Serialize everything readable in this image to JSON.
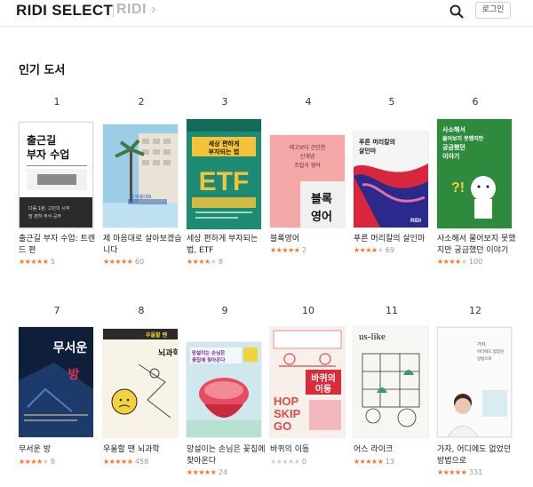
{
  "header": {
    "logo": "RIDI SELECT",
    "logo_secondary": "RIDI",
    "login_label": "로그인",
    "search_icon": "search-icon"
  },
  "section": {
    "title": "인기 도서"
  },
  "books": [
    {
      "rank": "1",
      "title": "출근길 부자 수업: 트렌드 편",
      "rating": 5,
      "reviews": "5",
      "cover_text": "출근길\n부자 수업",
      "cover_text_small": "다음 1분, 고민의 시작\n맘 편히 주식 공부"
    },
    {
      "rank": "2",
      "title": "제 마음대로 살아보겠습니다",
      "rating": 4.5,
      "reviews": "60",
      "cover_text": "제 마음대로 살아보겠습니다",
      "cover_text_small": ""
    },
    {
      "rank": "3",
      "title": "세상 편하게 부자되는 법, ETF",
      "rating": 3.5,
      "reviews": "8",
      "cover_text": "세상 편하게\n부자되는 법",
      "cover_text_small": "ETF"
    },
    {
      "rank": "4",
      "title": "블록영어",
      "rating": 5,
      "reviews": "2",
      "cover_text": "레고보다 간단한\n신개념\n조립식 영어",
      "cover_text_small": "블록\n영어"
    },
    {
      "rank": "5",
      "title": "푸른 머리칼의 살인마",
      "rating": 4,
      "reviews": "69",
      "cover_text": "푸른 머리칼의\n살인마",
      "cover_text_small": "RIDI"
    },
    {
      "rank": "6",
      "title": "사소해서 물어보지 못했지만 궁금했던 이야기",
      "rating": 4,
      "reviews": "100",
      "cover_text": "사소해서\n물어보지 못했지만\n궁금했던\n이야기",
      "cover_text_small": "?!"
    },
    {
      "rank": "7",
      "title": "무서운 방",
      "rating": 3.5,
      "reviews": "8",
      "cover_text": "무서운\n방",
      "cover_text_small": ""
    },
    {
      "rank": "8",
      "title": "우울할 땐 뇌과학",
      "rating": 4.5,
      "reviews": "458",
      "cover_text": "우울할 땐\n뇌과학",
      "cover_text_small": ""
    },
    {
      "rank": "9",
      "title": "망설이는 손님은 꽃집에 찾아온다",
      "rating": 4.5,
      "reviews": "24",
      "cover_text": "망설이는 손님은\n꽃집에 찾아온다",
      "cover_text_small": ""
    },
    {
      "rank": "10",
      "title": "바퀴의 이동",
      "rating": 0,
      "reviews": "0",
      "cover_text": "바퀴의\n이동",
      "cover_text_small": "HOP\nSKIP\nGO"
    },
    {
      "rank": "11",
      "title": "어스 라이크",
      "rating": 4.5,
      "reviews": "13",
      "cover_text": "us-like",
      "cover_text_small": ""
    },
    {
      "rank": "12",
      "title": "가자, 어디에도 없었던 방법으로",
      "rating": 4.5,
      "reviews": "331",
      "cover_text": "가자,\n어디에도 없었던\n방법으로",
      "cover_text_small": ""
    }
  ],
  "colors": {
    "star_on": "#fa722e",
    "star_off": "#cccccc"
  }
}
